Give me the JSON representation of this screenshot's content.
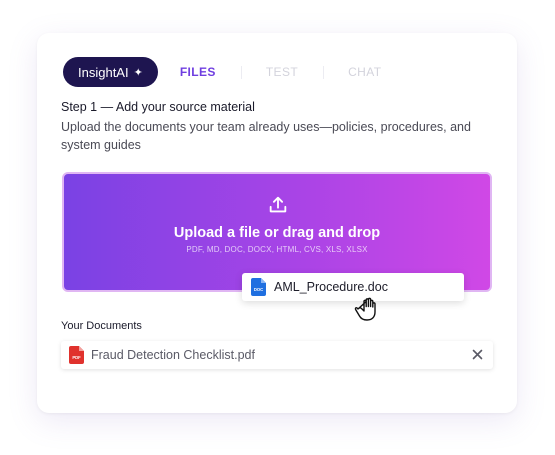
{
  "tabs": {
    "brand_label": "InsightAI",
    "items": [
      {
        "label": "FILES"
      },
      {
        "label": "TEST"
      },
      {
        "label": "CHAT"
      }
    ]
  },
  "step": {
    "title": "Step 1 — Add your source material",
    "description": "Upload the documents your team already uses—policies, procedures, and system guides"
  },
  "dropzone": {
    "title": "Upload a file or drag and drop",
    "formats": "PDF, MD, DOC, DOCX, HTML, CVS, XLS, XLSX"
  },
  "dragged_file": {
    "name": "AML_Procedure.doc",
    "icon_text": "DOC"
  },
  "documents": {
    "label": "Your Documents",
    "items": [
      {
        "name": "Fraud Detection Checklist.pdf",
        "icon_text": "PDF"
      }
    ]
  },
  "colors": {
    "brand_tab_bg": "#1e1550",
    "active_tab": "#6f3ee0",
    "dropzone_start": "#7a42e4",
    "dropzone_end": "#d048e6",
    "doc_icon": "#1f6fe0",
    "pdf_icon": "#e0322d"
  },
  "icons": [
    "sparkle-icon",
    "upload-icon",
    "doc-file-icon",
    "grab-hand-icon",
    "pdf-file-icon",
    "close-icon"
  ]
}
